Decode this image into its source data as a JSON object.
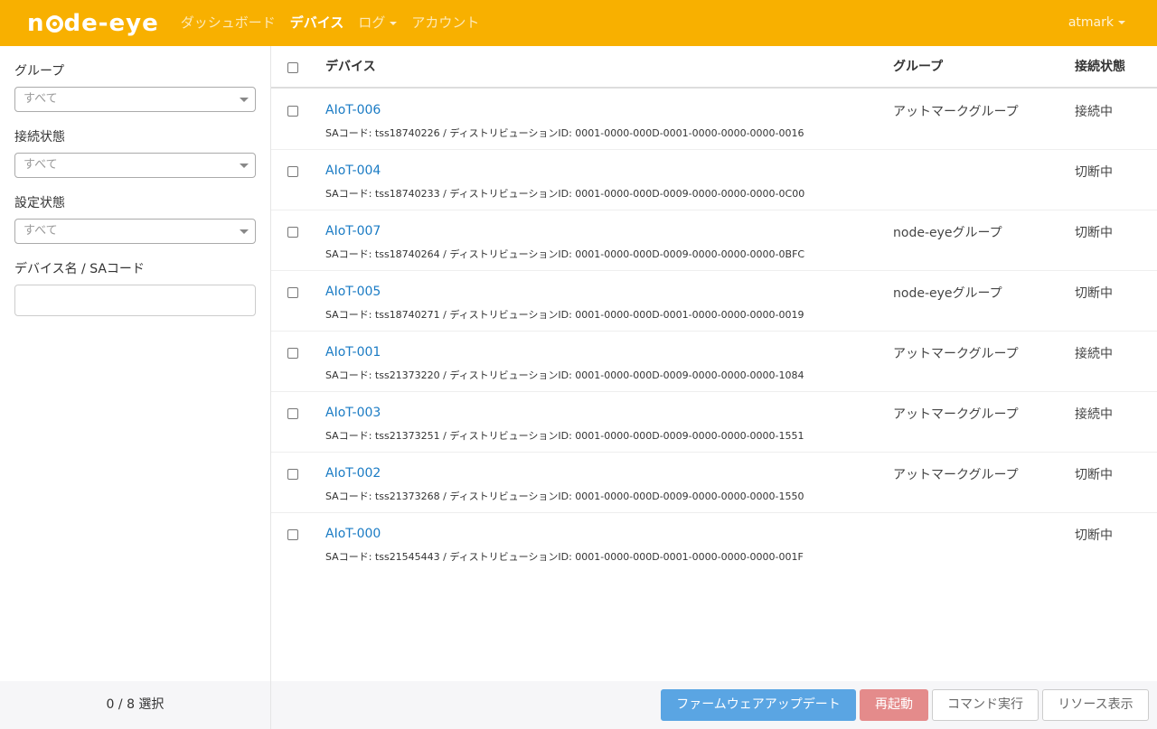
{
  "navbar": {
    "logo": "node-eye",
    "links": [
      {
        "label": "ダッシュボード"
      },
      {
        "label": "デバイス"
      },
      {
        "label": "ログ"
      },
      {
        "label": "アカウント"
      }
    ],
    "user": "atmark"
  },
  "sidebar": {
    "group_label": "グループ",
    "group_value": "すべて",
    "connection_label": "接続状態",
    "connection_value": "すべて",
    "config_label": "設定状態",
    "config_value": "すべて",
    "search_label": "デバイス名 / SAコード",
    "search_value": ""
  },
  "table": {
    "headers": {
      "device": "デバイス",
      "group": "グループ",
      "status": "接続状態"
    },
    "rows": [
      {
        "name": "AIoT-006",
        "sub": "SAコード: tss18740226 / ディストリビューションID: 0001-0000-000D-0001-0000-0000-0000-0016",
        "group": "アットマークグループ",
        "status": "接続中"
      },
      {
        "name": "AIoT-004",
        "sub": "SAコード: tss18740233 / ディストリビューションID: 0001-0000-000D-0009-0000-0000-0000-0C00",
        "group": "",
        "status": "切断中"
      },
      {
        "name": "AIoT-007",
        "sub": "SAコード: tss18740264 / ディストリビューションID: 0001-0000-000D-0009-0000-0000-0000-0BFC",
        "group": "node-eyeグループ",
        "status": "切断中"
      },
      {
        "name": "AIoT-005",
        "sub": "SAコード: tss18740271 / ディストリビューションID: 0001-0000-000D-0001-0000-0000-0000-0019",
        "group": "node-eyeグループ",
        "status": "切断中"
      },
      {
        "name": "AIoT-001",
        "sub": "SAコード: tss21373220 / ディストリビューションID: 0001-0000-000D-0009-0000-0000-0000-1084",
        "group": "アットマークグループ",
        "status": "接続中"
      },
      {
        "name": "AIoT-003",
        "sub": "SAコード: tss21373251 / ディストリビューションID: 0001-0000-000D-0009-0000-0000-0000-1551",
        "group": "アットマークグループ",
        "status": "接続中"
      },
      {
        "name": "AIoT-002",
        "sub": "SAコード: tss21373268 / ディストリビューションID: 0001-0000-000D-0009-0000-0000-0000-1550",
        "group": "アットマークグループ",
        "status": "切断中"
      },
      {
        "name": "AIoT-000",
        "sub": "SAコード: tss21545443 / ディストリビューションID: 0001-0000-000D-0001-0000-0000-0000-001F",
        "group": "",
        "status": "切断中"
      }
    ]
  },
  "footer": {
    "selection": "0 / 8 選択",
    "firmware_button": "ファームウェアアップデート",
    "reboot_button": "再起動",
    "command_button": "コマンド実行",
    "resource_button": "リソース表示"
  },
  "colors": {
    "navbar": "#f8b000",
    "link": "#1a7bc4",
    "primary": "#5aa5e3",
    "danger": "#e48b8b"
  }
}
